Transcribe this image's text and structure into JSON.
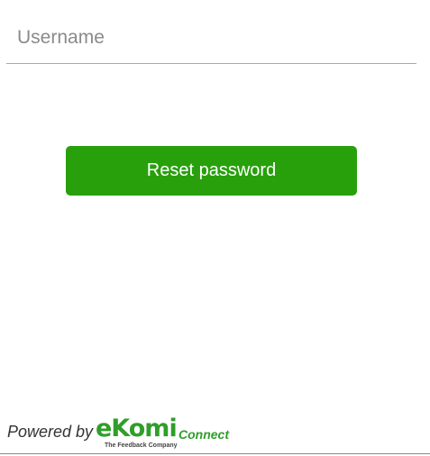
{
  "form": {
    "username_placeholder": "Username",
    "username_value": "",
    "reset_label": "Reset password"
  },
  "footer": {
    "powered_by": "Powered by",
    "logo_wordmark": "eKomi",
    "logo_product": "Connect",
    "logo_tagline": "The Feedback Company"
  },
  "colors": {
    "brand_green": "#28a00c",
    "logo_green": "#2f9e2a",
    "field_rule": "#a9a9a9"
  }
}
